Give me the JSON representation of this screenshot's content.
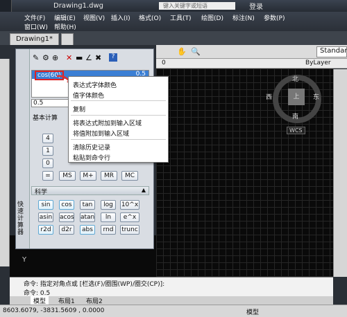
{
  "title": {
    "file": "Drawing1.dwg",
    "search": "键入关键字或短语",
    "login": "登录"
  },
  "menu": [
    "文件(F)",
    "编辑(E)",
    "视图(V)",
    "插入(I)",
    "格式(O)",
    "工具(T)",
    "绘图(D)",
    "标注(N)",
    "参数(P)",
    "窗口(W)",
    "帮助(H)"
  ],
  "tabs": {
    "drawing": "Drawing1*"
  },
  "toolbar": {
    "standard": "Standar",
    "layer": "0",
    "bylayer": "ByLayer"
  },
  "calc": {
    "expression": "cos(60)",
    "result": "0.5",
    "result2": "0.5",
    "basic_label": "基本计算",
    "sci_label": "科学",
    "num_buttons": [
      "4",
      "1",
      "0",
      "="
    ],
    "row_buttons": [
      "MS",
      "M+",
      "MR",
      "MC"
    ],
    "sci_rows": [
      [
        "sin",
        "cos",
        "tan",
        "log",
        "10^x"
      ],
      [
        "asin",
        "acos",
        "atan",
        "ln",
        "e^x"
      ],
      [
        "r2d",
        "d2r",
        "abs",
        "rnd",
        "trunc"
      ]
    ],
    "side_label": "快速计算器"
  },
  "context_menu": [
    "表达式字体颜色",
    "值字体颜色",
    "复制",
    "将表达式附加到输入区域",
    "将值附加到输入区域",
    "清除历史记录",
    "粘贴到命令行"
  ],
  "compass": {
    "north": "北",
    "south": "南",
    "east": "东",
    "west": "西",
    "center": "上",
    "wcs": "WCS"
  },
  "command": {
    "line1": "命令: 指定对角点或 [栏选(F)/圈围(WP)/圈交(CP)]:",
    "line2": "命令: 0.5"
  },
  "layout_tabs": [
    "模型",
    "布局1",
    "布局2"
  ],
  "status": {
    "coords": "8603.6079, -3831.5609 , 0.0000",
    "model": "模型"
  }
}
